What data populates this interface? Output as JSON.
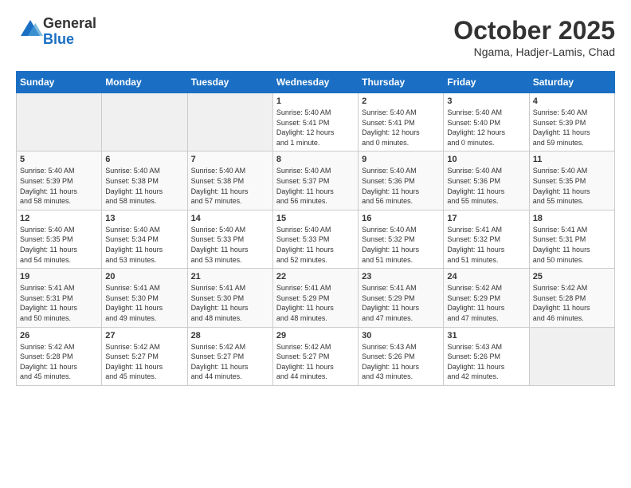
{
  "header": {
    "logo_general": "General",
    "logo_blue": "Blue",
    "month_title": "October 2025",
    "location": "Ngama, Hadjer-Lamis, Chad"
  },
  "calendar": {
    "days_of_week": [
      "Sunday",
      "Monday",
      "Tuesday",
      "Wednesday",
      "Thursday",
      "Friday",
      "Saturday"
    ],
    "weeks": [
      [
        {
          "day": "",
          "info": ""
        },
        {
          "day": "",
          "info": ""
        },
        {
          "day": "",
          "info": ""
        },
        {
          "day": "1",
          "info": "Sunrise: 5:40 AM\nSunset: 5:41 PM\nDaylight: 12 hours\nand 1 minute."
        },
        {
          "day": "2",
          "info": "Sunrise: 5:40 AM\nSunset: 5:41 PM\nDaylight: 12 hours\nand 0 minutes."
        },
        {
          "day": "3",
          "info": "Sunrise: 5:40 AM\nSunset: 5:40 PM\nDaylight: 12 hours\nand 0 minutes."
        },
        {
          "day": "4",
          "info": "Sunrise: 5:40 AM\nSunset: 5:39 PM\nDaylight: 11 hours\nand 59 minutes."
        }
      ],
      [
        {
          "day": "5",
          "info": "Sunrise: 5:40 AM\nSunset: 5:39 PM\nDaylight: 11 hours\nand 58 minutes."
        },
        {
          "day": "6",
          "info": "Sunrise: 5:40 AM\nSunset: 5:38 PM\nDaylight: 11 hours\nand 58 minutes."
        },
        {
          "day": "7",
          "info": "Sunrise: 5:40 AM\nSunset: 5:38 PM\nDaylight: 11 hours\nand 57 minutes."
        },
        {
          "day": "8",
          "info": "Sunrise: 5:40 AM\nSunset: 5:37 PM\nDaylight: 11 hours\nand 56 minutes."
        },
        {
          "day": "9",
          "info": "Sunrise: 5:40 AM\nSunset: 5:36 PM\nDaylight: 11 hours\nand 56 minutes."
        },
        {
          "day": "10",
          "info": "Sunrise: 5:40 AM\nSunset: 5:36 PM\nDaylight: 11 hours\nand 55 minutes."
        },
        {
          "day": "11",
          "info": "Sunrise: 5:40 AM\nSunset: 5:35 PM\nDaylight: 11 hours\nand 55 minutes."
        }
      ],
      [
        {
          "day": "12",
          "info": "Sunrise: 5:40 AM\nSunset: 5:35 PM\nDaylight: 11 hours\nand 54 minutes."
        },
        {
          "day": "13",
          "info": "Sunrise: 5:40 AM\nSunset: 5:34 PM\nDaylight: 11 hours\nand 53 minutes."
        },
        {
          "day": "14",
          "info": "Sunrise: 5:40 AM\nSunset: 5:33 PM\nDaylight: 11 hours\nand 53 minutes."
        },
        {
          "day": "15",
          "info": "Sunrise: 5:40 AM\nSunset: 5:33 PM\nDaylight: 11 hours\nand 52 minutes."
        },
        {
          "day": "16",
          "info": "Sunrise: 5:40 AM\nSunset: 5:32 PM\nDaylight: 11 hours\nand 51 minutes."
        },
        {
          "day": "17",
          "info": "Sunrise: 5:41 AM\nSunset: 5:32 PM\nDaylight: 11 hours\nand 51 minutes."
        },
        {
          "day": "18",
          "info": "Sunrise: 5:41 AM\nSunset: 5:31 PM\nDaylight: 11 hours\nand 50 minutes."
        }
      ],
      [
        {
          "day": "19",
          "info": "Sunrise: 5:41 AM\nSunset: 5:31 PM\nDaylight: 11 hours\nand 50 minutes."
        },
        {
          "day": "20",
          "info": "Sunrise: 5:41 AM\nSunset: 5:30 PM\nDaylight: 11 hours\nand 49 minutes."
        },
        {
          "day": "21",
          "info": "Sunrise: 5:41 AM\nSunset: 5:30 PM\nDaylight: 11 hours\nand 48 minutes."
        },
        {
          "day": "22",
          "info": "Sunrise: 5:41 AM\nSunset: 5:29 PM\nDaylight: 11 hours\nand 48 minutes."
        },
        {
          "day": "23",
          "info": "Sunrise: 5:41 AM\nSunset: 5:29 PM\nDaylight: 11 hours\nand 47 minutes."
        },
        {
          "day": "24",
          "info": "Sunrise: 5:42 AM\nSunset: 5:29 PM\nDaylight: 11 hours\nand 47 minutes."
        },
        {
          "day": "25",
          "info": "Sunrise: 5:42 AM\nSunset: 5:28 PM\nDaylight: 11 hours\nand 46 minutes."
        }
      ],
      [
        {
          "day": "26",
          "info": "Sunrise: 5:42 AM\nSunset: 5:28 PM\nDaylight: 11 hours\nand 45 minutes."
        },
        {
          "day": "27",
          "info": "Sunrise: 5:42 AM\nSunset: 5:27 PM\nDaylight: 11 hours\nand 45 minutes."
        },
        {
          "day": "28",
          "info": "Sunrise: 5:42 AM\nSunset: 5:27 PM\nDaylight: 11 hours\nand 44 minutes."
        },
        {
          "day": "29",
          "info": "Sunrise: 5:42 AM\nSunset: 5:27 PM\nDaylight: 11 hours\nand 44 minutes."
        },
        {
          "day": "30",
          "info": "Sunrise: 5:43 AM\nSunset: 5:26 PM\nDaylight: 11 hours\nand 43 minutes."
        },
        {
          "day": "31",
          "info": "Sunrise: 5:43 AM\nSunset: 5:26 PM\nDaylight: 11 hours\nand 42 minutes."
        },
        {
          "day": "",
          "info": ""
        }
      ]
    ]
  }
}
